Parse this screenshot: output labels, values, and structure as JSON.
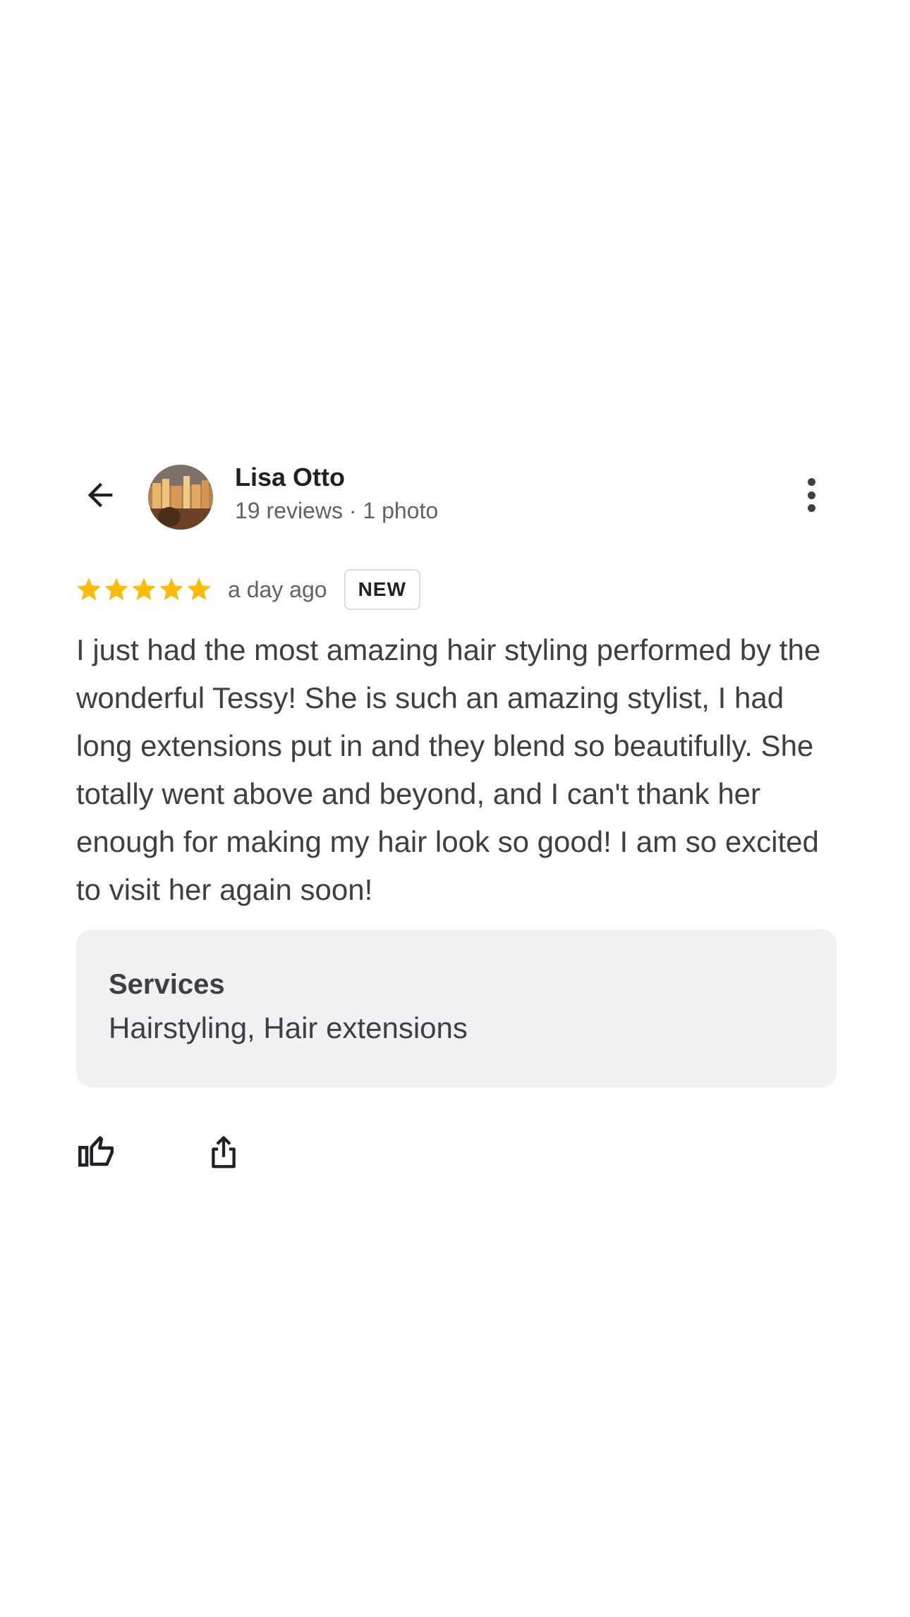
{
  "reviewer": {
    "name": "Lisa Otto",
    "meta": "19 reviews · 1 photo"
  },
  "review": {
    "rating": 5,
    "rating_max": 5,
    "date": "a day ago",
    "badge": "NEW",
    "text": "I just had the most amazing hair styling performed by the wonderful Tessy! She is such an amazing stylist, I had long extensions put in and they blend so beautifully. She totally went above and beyond, and I can't thank her enough for making my hair look so good! I am so excited to visit her again soon!"
  },
  "services": {
    "title": "Services",
    "value": "Hairstyling, Hair extensions"
  },
  "icons": {
    "back": "arrow-back-icon",
    "more": "more-vert-icon",
    "star": "star-icon",
    "like": "thumb-up-icon",
    "share": "share-icon"
  },
  "colors": {
    "star": "#fbbc04",
    "text_primary": "#202124",
    "text_secondary": "#5f6368",
    "card_bg": "#f1f1f3"
  }
}
